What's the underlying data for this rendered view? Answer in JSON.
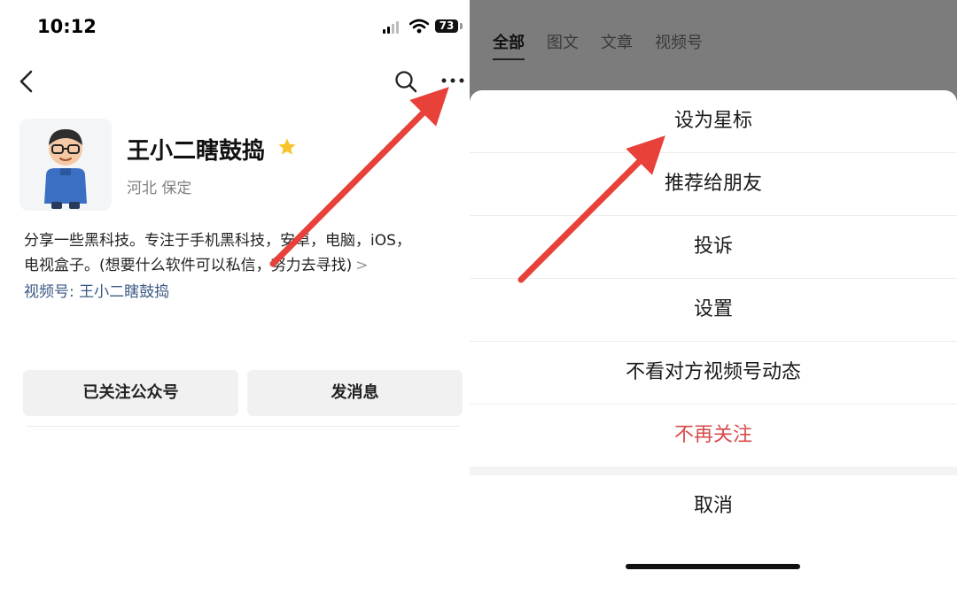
{
  "status_bar": {
    "time": "10:12",
    "battery": "73"
  },
  "profile": {
    "name": "王小二瞎鼓捣",
    "location": "河北 保定",
    "bio_line1": "分享一些黑科技。专注于手机黑科技，安卓，电脑，iOS，",
    "bio_line2": "电视盒子。(想要什么软件可以私信，努力去寻找)",
    "bio_chevron": ">",
    "channel": "视频号: 王小二瞎鼓捣"
  },
  "actions": {
    "follow_label": "已关注公众号",
    "message_label": "发消息"
  },
  "tabs": [
    {
      "label": "全部",
      "active": true
    },
    {
      "label": "图文",
      "active": false
    },
    {
      "label": "文章",
      "active": false
    },
    {
      "label": "视频号",
      "active": false
    }
  ],
  "menu": {
    "items": [
      {
        "label": "设为星标"
      },
      {
        "label": "推荐给朋友"
      },
      {
        "label": "投诉"
      },
      {
        "label": "设置"
      },
      {
        "label": "不看对方视频号动态"
      },
      {
        "label": "不再关注"
      }
    ],
    "cancel_label": "取消",
    "danger_color": "#d84a4a"
  },
  "icons": [
    "back-chevron-icon",
    "search-icon",
    "more-dots-icon",
    "star-icon",
    "signal-icon",
    "wifi-icon",
    "battery-icon"
  ],
  "accent_colors": {
    "arrow": "#e8413a",
    "star": "#f7c52b",
    "link": "#3b5a84"
  }
}
